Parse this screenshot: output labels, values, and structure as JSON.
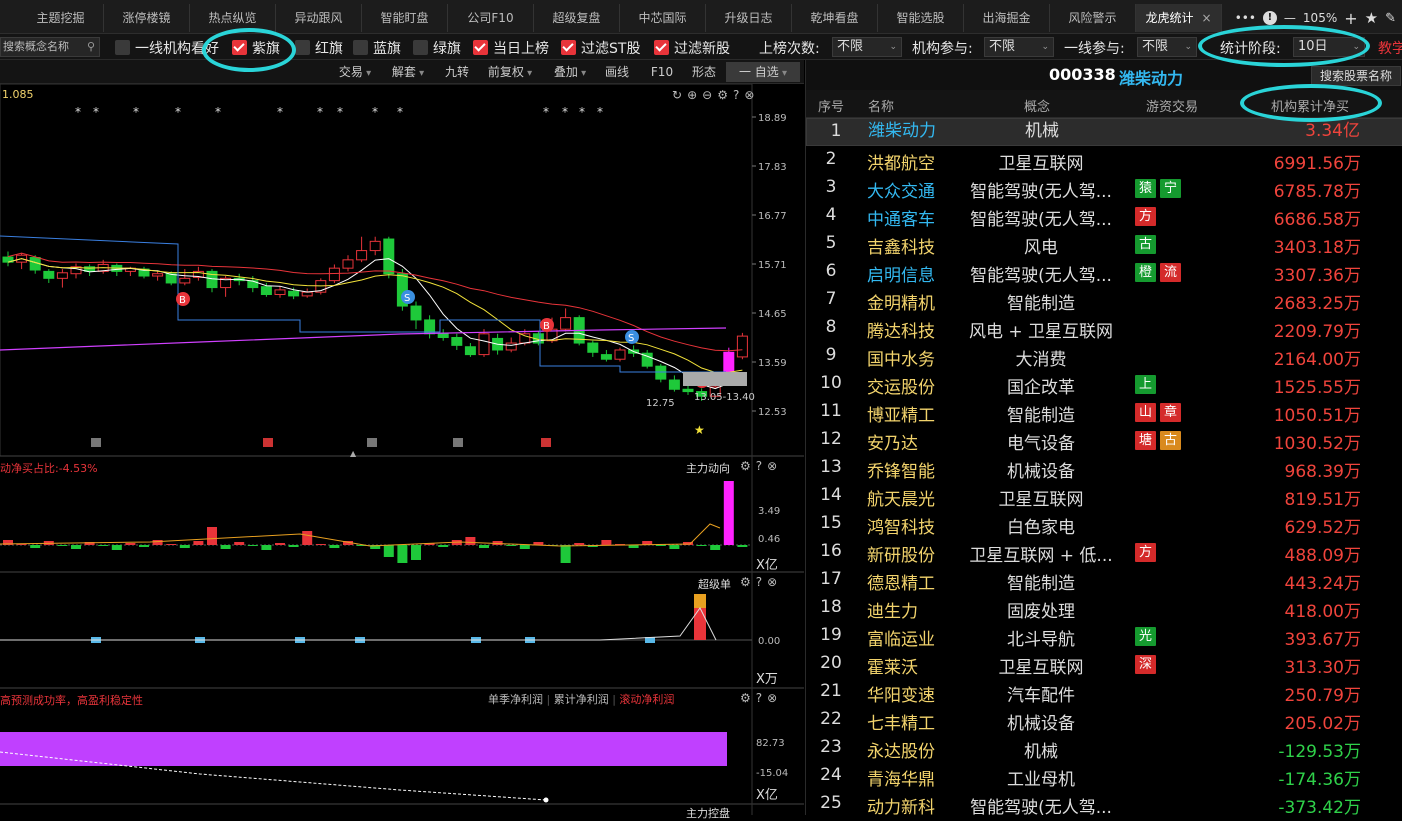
{
  "tabs": [
    "主题挖掘",
    "涨停楼镜",
    "热点纵览",
    "异动跟风",
    "智能盯盘",
    "公司F10",
    "超级复盘",
    "中芯国际",
    "升级日志",
    "乾坤看盘",
    "智能选股",
    "出海掘金",
    "风险警示",
    "龙虎统计"
  ],
  "active_tab": "龙虎统计",
  "tab_close": "×",
  "window_controls": {
    "zoom": "105%",
    "more": "•••",
    "minus": "—",
    "plus": "+"
  },
  "filters": {
    "search_placeholder": "搜索概念名称",
    "checks": [
      {
        "label": "一线机构看好",
        "checked": false
      },
      {
        "label": "紫旗",
        "checked": true
      },
      {
        "label": "红旗",
        "checked": false
      },
      {
        "label": "蓝旗",
        "checked": false
      },
      {
        "label": "绿旗",
        "checked": false
      },
      {
        "label": "当日上榜",
        "checked": true
      },
      {
        "label": "过滤ST股",
        "checked": true
      },
      {
        "label": "过滤新股",
        "checked": true
      }
    ],
    "selects": [
      {
        "label": "上榜次数:",
        "value": "不限"
      },
      {
        "label": "机构参与:",
        "value": "不限"
      },
      {
        "label": "一线参与:",
        "value": "不限"
      },
      {
        "label": "统计阶段:",
        "value": "10日"
      }
    ],
    "teach": "教学"
  },
  "chart_toolbar": [
    "交易",
    "解套",
    "九转",
    "前复权",
    "叠加",
    "画线",
    "F10",
    "形态",
    "一 自选"
  ],
  "main_panel": {
    "value_label": "1.085",
    "y_ticks": [
      "18.89",
      "17.83",
      "16.77",
      "15.71",
      "14.65",
      "13.59",
      "12.53"
    ],
    "low_label": "12.75",
    "range_label": "13.05-13.40",
    "marker_b": "B",
    "marker_s": "S"
  },
  "panel2": {
    "title": "动净买占比:-4.53%",
    "name": "主力动向",
    "ticks": [
      "3.49",
      "0.46"
    ],
    "unit": "X亿"
  },
  "panel3": {
    "name": "超级单",
    "ticks": [
      "0.00"
    ],
    "unit": "X万"
  },
  "panel4": {
    "title": "高预测成功率，高盈利稳定性",
    "legend": [
      "单季净利润",
      "累计净利润",
      "滚动净利润"
    ],
    "ticks": [
      "82.73",
      "-15.04"
    ],
    "unit": "X亿",
    "next": "主力控盘"
  },
  "stock": {
    "code": "000338",
    "name": "潍柴动力",
    "search_button": "搜索股票名称"
  },
  "table": {
    "headers": [
      "序号",
      "名称",
      "概念",
      "游资交易",
      "机构累计净买"
    ],
    "rows": [
      {
        "idx": "1",
        "name": "潍柴动力",
        "concept": "机械",
        "badges": [],
        "value": "3.34亿",
        "hl": true
      },
      {
        "idx": "2",
        "name": "洪都航空",
        "concept": "卫星互联网",
        "badges": [],
        "value": "6991.56万",
        "hl": false
      },
      {
        "idx": "3",
        "name": "大众交通",
        "concept": "智能驾驶(无人驾...",
        "badges": [
          {
            "t": "猿",
            "c": "#159a2f"
          },
          {
            "t": "宁",
            "c": "#159a2f"
          }
        ],
        "value": "6785.78万",
        "hl": true
      },
      {
        "idx": "4",
        "name": "中通客车",
        "concept": "智能驾驶(无人驾...",
        "badges": [
          {
            "t": "方",
            "c": "#d42a2a"
          }
        ],
        "value": "6686.58万",
        "hl": true
      },
      {
        "idx": "5",
        "name": "吉鑫科技",
        "concept": "风电",
        "badges": [
          {
            "t": "古",
            "c": "#159a2f"
          }
        ],
        "value": "3403.18万",
        "hl": false
      },
      {
        "idx": "6",
        "name": "启明信息",
        "concept": "智能驾驶(无人驾...",
        "badges": [
          {
            "t": "橙",
            "c": "#159a2f"
          },
          {
            "t": "流",
            "c": "#d42a2a"
          }
        ],
        "value": "3307.36万",
        "hl": true
      },
      {
        "idx": "7",
        "name": "金明精机",
        "concept": "智能制造",
        "badges": [],
        "value": "2683.25万",
        "hl": false
      },
      {
        "idx": "8",
        "name": "腾达科技",
        "concept": "风电 + 卫星互联网",
        "badges": [],
        "value": "2209.79万",
        "hl": false
      },
      {
        "idx": "9",
        "name": "国中水务",
        "concept": "大消费",
        "badges": [],
        "value": "2164.00万",
        "hl": false
      },
      {
        "idx": "10",
        "name": "交运股份",
        "concept": "国企改革",
        "badges": [
          {
            "t": "上",
            "c": "#159a2f"
          }
        ],
        "value": "1525.55万",
        "hl": false
      },
      {
        "idx": "11",
        "name": "博亚精工",
        "concept": "智能制造",
        "badges": [
          {
            "t": "山",
            "c": "#d42a2a"
          },
          {
            "t": "章",
            "c": "#d42a2a"
          }
        ],
        "value": "1050.51万",
        "hl": false
      },
      {
        "idx": "12",
        "name": "安乃达",
        "concept": "电气设备",
        "badges": [
          {
            "t": "塘",
            "c": "#d42a2a"
          },
          {
            "t": "古",
            "c": "#d98a1e"
          }
        ],
        "value": "1030.52万",
        "hl": false
      },
      {
        "idx": "13",
        "name": "乔锋智能",
        "concept": "机械设备",
        "badges": [],
        "value": "968.39万",
        "hl": false
      },
      {
        "idx": "14",
        "name": "航天晨光",
        "concept": "卫星互联网",
        "badges": [],
        "value": "819.51万",
        "hl": false
      },
      {
        "idx": "15",
        "name": "鸿智科技",
        "concept": "白色家电",
        "badges": [],
        "value": "629.52万",
        "hl": false
      },
      {
        "idx": "16",
        "name": "新研股份",
        "concept": "卫星互联网 + 低...",
        "badges": [
          {
            "t": "方",
            "c": "#d42a2a"
          }
        ],
        "value": "488.09万",
        "hl": false
      },
      {
        "idx": "17",
        "name": "德恩精工",
        "concept": "智能制造",
        "badges": [],
        "value": "443.24万",
        "hl": false
      },
      {
        "idx": "18",
        "name": "迪生力",
        "concept": "固废处理",
        "badges": [],
        "value": "418.00万",
        "hl": false
      },
      {
        "idx": "19",
        "name": "富临运业",
        "concept": "北斗导航",
        "badges": [
          {
            "t": "光",
            "c": "#159a2f"
          }
        ],
        "value": "393.67万",
        "hl": false
      },
      {
        "idx": "20",
        "name": "霍莱沃",
        "concept": "卫星互联网",
        "badges": [
          {
            "t": "深",
            "c": "#d42a2a"
          }
        ],
        "value": "313.30万",
        "hl": false
      },
      {
        "idx": "21",
        "name": "华阳变速",
        "concept": "汽车配件",
        "badges": [],
        "value": "250.79万",
        "hl": false
      },
      {
        "idx": "22",
        "name": "七丰精工",
        "concept": "机械设备",
        "badges": [],
        "value": "205.02万",
        "hl": false
      },
      {
        "idx": "23",
        "name": "永达股份",
        "concept": "机械",
        "badges": [],
        "value": "-129.53万",
        "hl": false
      },
      {
        "idx": "24",
        "name": "青海华鼎",
        "concept": "工业母机",
        "badges": [],
        "value": "-174.36万",
        "hl": false
      },
      {
        "idx": "25",
        "name": "动力新科",
        "concept": "智能驾驶(无人驾...",
        "badges": [],
        "value": "-373.42万",
        "hl": false
      }
    ]
  },
  "colors": {
    "up": "#e8343a",
    "down": "#1ec93a",
    "pos_value": "#f0443c",
    "neg_value": "#2fd14a",
    "highlight_name": "#33b8f0",
    "name": "#f2d36c",
    "annot": "#2ad4d8",
    "purple": "#c040ff"
  }
}
